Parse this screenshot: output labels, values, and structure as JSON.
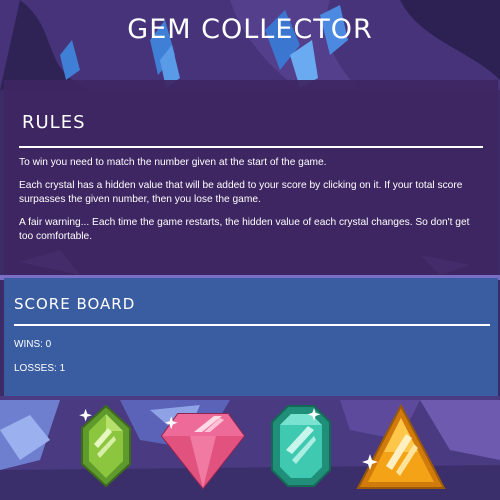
{
  "title": "GEM COLLECTOR",
  "rules": {
    "heading": "RULES",
    "paragraphs": [
      "To win you need to match the number given at the start of the game.",
      "Each crystal has a hidden value that will be added to your score by clicking on it. If your total score surpasses the given number, then you lose the game.",
      "A fair warning... Each time the game restarts, the hidden value of each crystal changes. So don't get too comfortable."
    ]
  },
  "scoreboard": {
    "heading": "SCORE BOARD",
    "wins": "WINS: 0",
    "losses": "LOSSES: 1"
  },
  "crystals": [
    {
      "icon": "green-hexagon-gem-icon",
      "color": "#8cc63f"
    },
    {
      "icon": "pink-diamond-gem-icon",
      "color": "#ec5a8c"
    },
    {
      "icon": "teal-octagon-gem-icon",
      "color": "#3ec9b0"
    },
    {
      "icon": "orange-triangle-gem-icon",
      "color": "#f5a316"
    }
  ],
  "colors": {
    "rules_panel": "#3e2662",
    "scoreboard_panel": "#3a5da2",
    "cave_background": "#3a2a63"
  }
}
